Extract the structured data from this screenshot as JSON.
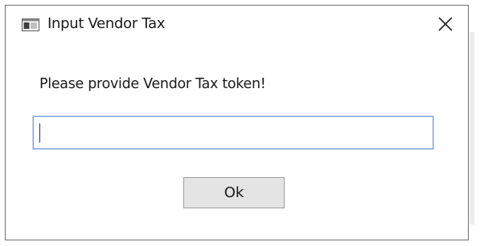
{
  "window": {
    "title": "Input Vendor Tax",
    "app_icon": "app-window-icon",
    "close_icon": "close-icon"
  },
  "prompt": {
    "message": "Please provide Vendor Tax token!"
  },
  "token_input": {
    "value": "",
    "placeholder": ""
  },
  "buttons": {
    "ok_label": "Ok"
  },
  "colors": {
    "input_focus_border": "#7aa0d8",
    "button_bg": "#e4e4e4"
  }
}
